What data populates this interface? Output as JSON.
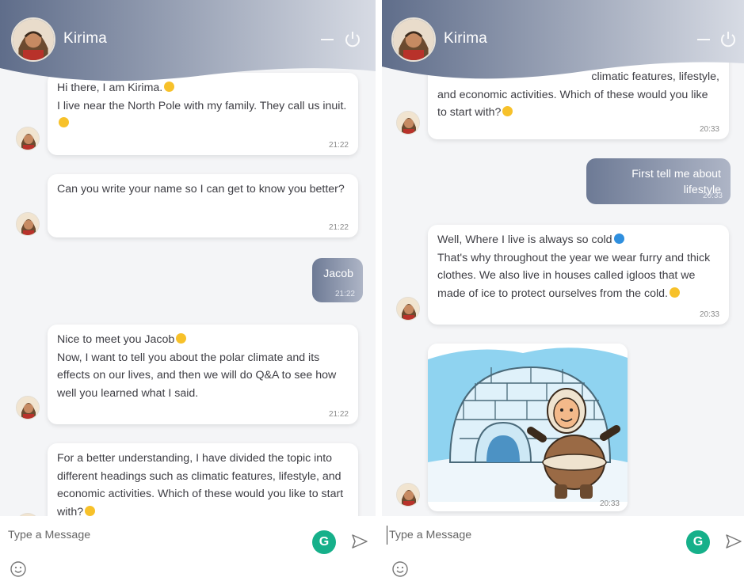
{
  "left": {
    "header": {
      "title": "Kirima"
    },
    "messages": [
      {
        "who": "bot",
        "text": "Hi there, I am Kirima.",
        "time": "21:22"
      },
      {
        "who": "bot",
        "text": "I live near the North Pole with my family. They call us inuit.",
        "time": ""
      },
      {
        "who": "bot",
        "text": "Can you write your name so I can get to know you better?",
        "time": "21:22"
      },
      {
        "who": "user",
        "text": "Jacob",
        "time": "21:22"
      },
      {
        "who": "bot",
        "text": "Nice to meet you Jacob",
        "time": ""
      },
      {
        "who": "bot",
        "text": "Now, I want to tell you about the polar climate and its effects on our lives, and then we will do Q&A to see how well you learned what I said.",
        "time": "21:22"
      },
      {
        "who": "bot",
        "text": "For a better understanding, I have divided the topic into different headings such as climatic features, lifestyle, and economic activities. Which of these would you like to start with?",
        "time": ""
      }
    ],
    "footer": {
      "placeholder": "Type a Message"
    }
  },
  "right": {
    "header": {
      "title": "Kirima"
    },
    "messages": [
      {
        "who": "bot",
        "text": "climatic features, lifestyle,",
        "time": ""
      },
      {
        "who": "bot",
        "text": "and economic activities. Which of these would you like to start with?",
        "time": "20:33"
      },
      {
        "who": "user",
        "text": "First tell me about lifestyle",
        "time": "20:33"
      },
      {
        "who": "bot",
        "text": "Well, Where I live is always so cold",
        "time": ""
      },
      {
        "who": "bot",
        "text": "That's why throughout the year we wear furry and thick clothes. We also live in houses called igloos that we made of ice to protect ourselves from the cold.",
        "time": "20:33"
      },
      {
        "who": "bot",
        "text": "",
        "time": "20:33",
        "image": "igloo-illustration"
      }
    ],
    "footer": {
      "placeholder": "Type a Message"
    }
  },
  "icons": {
    "minimize": "minimize-icon",
    "power": "power-icon",
    "send": "send-icon",
    "emoji": "emoji-icon",
    "grammarly": "grammarly-icon"
  },
  "grammarly_letter": "G",
  "colors": {
    "header_gradient_start": "#5f6d8a",
    "header_gradient_end": "#d7dbe4",
    "sent_bubble": "#7d89a3",
    "grammarly": "#16b08a"
  }
}
